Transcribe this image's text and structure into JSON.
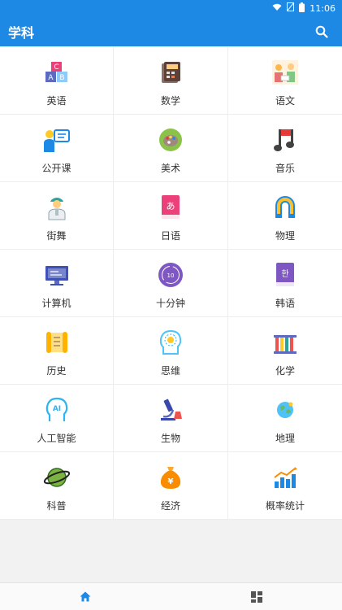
{
  "status_bar": {
    "time": "11:06",
    "icons": [
      "wifi-icon",
      "signal-off-icon",
      "battery-icon"
    ]
  },
  "app_bar": {
    "title": "学科",
    "action_icon": "search-icon"
  },
  "subjects": [
    {
      "label": "英语",
      "icon": "abc-blocks-icon"
    },
    {
      "label": "数学",
      "icon": "calculator-icon"
    },
    {
      "label": "语文",
      "icon": "chinese-reading-icon"
    },
    {
      "label": "公开课",
      "icon": "open-class-icon"
    },
    {
      "label": "美术",
      "icon": "palette-icon"
    },
    {
      "label": "音乐",
      "icon": "music-note-icon"
    },
    {
      "label": "街舞",
      "icon": "street-dance-icon"
    },
    {
      "label": "日语",
      "icon": "japanese-book-icon"
    },
    {
      "label": "物理",
      "icon": "magnet-icon"
    },
    {
      "label": "计算机",
      "icon": "computer-icon"
    },
    {
      "label": "十分钟",
      "icon": "ten-minutes-icon"
    },
    {
      "label": "韩语",
      "icon": "korean-book-icon"
    },
    {
      "label": "历史",
      "icon": "scroll-icon"
    },
    {
      "label": "思维",
      "icon": "brain-head-icon"
    },
    {
      "label": "化学",
      "icon": "test-tubes-icon"
    },
    {
      "label": "人工智能",
      "icon": "ai-head-icon"
    },
    {
      "label": "生物",
      "icon": "microscope-icon"
    },
    {
      "label": "地理",
      "icon": "globe-icon"
    },
    {
      "label": "科普",
      "icon": "planet-icon"
    },
    {
      "label": "经济",
      "icon": "money-bag-icon"
    },
    {
      "label": "概率统计",
      "icon": "statistics-chart-icon"
    }
  ],
  "bottom_nav": [
    {
      "icon": "home-icon",
      "active": true,
      "color": "#1e88e5"
    },
    {
      "icon": "dashboard-icon",
      "active": false,
      "color": "#555555"
    }
  ],
  "colors": {
    "primary": "#1e88e5",
    "background": "#f2f2f2"
  }
}
